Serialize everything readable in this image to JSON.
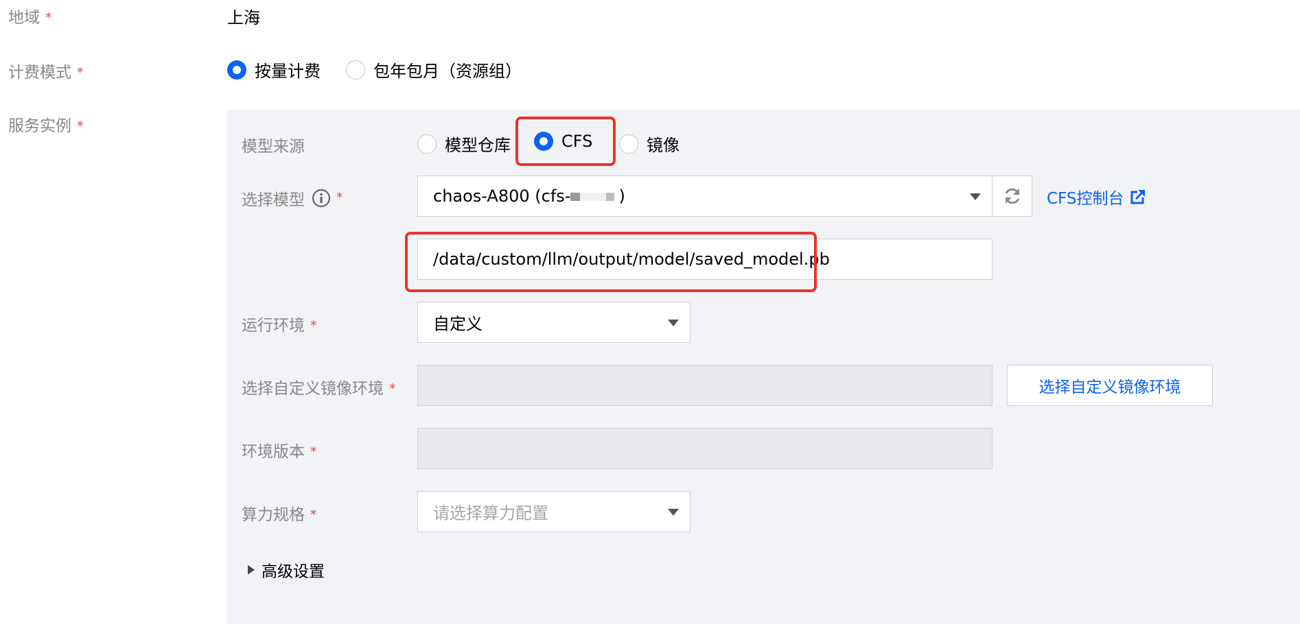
{
  "region": {
    "label": "地域",
    "value": "上海"
  },
  "billing": {
    "label": "计费模式",
    "options": [
      "按量计费",
      "包年包月（资源组）"
    ],
    "selected": 0
  },
  "service_instance": {
    "label": "服务实例",
    "model_source": {
      "label": "模型来源",
      "options": [
        "模型仓库",
        "CFS",
        "镜像"
      ],
      "selected": 1
    },
    "select_model": {
      "label": "选择模型",
      "value_prefix": "chaos-A800 (cfs-",
      "value_suffix": ")",
      "refresh_icon": "refresh-icon",
      "console_link": "CFS控制台",
      "external_icon": "external-link-icon",
      "path_value": "/data/custom/llm/output/model/saved_model.pb"
    },
    "runtime_env": {
      "label": "运行环境",
      "value": "自定义"
    },
    "custom_image": {
      "label": "选择自定义镜像环境",
      "button": "选择自定义镜像环境"
    },
    "env_version": {
      "label": "环境版本"
    },
    "compute_spec": {
      "label": "算力规格",
      "placeholder": "请选择算力配置"
    },
    "advanced": {
      "label": "高级设置"
    }
  },
  "colors": {
    "accent": "#0c62f3",
    "required": "#e54545",
    "highlight": "#e8332a",
    "panel": "#f2f3f6"
  }
}
